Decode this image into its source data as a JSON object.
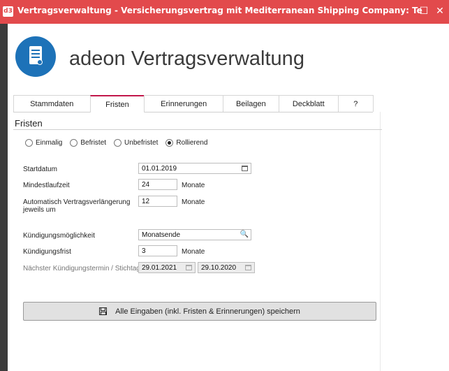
{
  "window": {
    "app_badge": "d3",
    "title": "Vertragsverwaltung - Versicherungsvertrag mit Mediterranean Shipping Company: Test Vertrag (Busines...",
    "maximize_icon": "☐",
    "close_icon": "✕"
  },
  "app": {
    "name": "adeon Vertragsverwaltung"
  },
  "tabs": [
    "Stammdaten",
    "Fristen",
    "Erinnerungen",
    "Beilagen",
    "Deckblatt",
    "?"
  ],
  "active_tab": "Fristen",
  "section": {
    "title": "Fristen"
  },
  "radios": [
    {
      "label": "Einmalig",
      "selected": false
    },
    {
      "label": "Befristet",
      "selected": false
    },
    {
      "label": "Unbefristet",
      "selected": false
    },
    {
      "label": "Rollierend",
      "selected": true
    }
  ],
  "form": {
    "startdatum": {
      "label": "Startdatum",
      "value": "01.01.2019"
    },
    "mindestlaufzeit": {
      "label": "Mindestlaufzeit",
      "value": "24",
      "unit": "Monate"
    },
    "verlaengerung": {
      "label": "Automatisch Vertragsverlängerung jeweils um",
      "value": "12",
      "unit": "Monate"
    },
    "kuendigungsmoeglichkeit": {
      "label": "Kündigungsmöglichkeit",
      "value": "Monatsende"
    },
    "kuendigungsfrist": {
      "label": "Kündigungsfrist",
      "value": "3",
      "unit": "Monate"
    },
    "naechster_termin": {
      "label": "Nächster Kündigungstermin / Stichtag",
      "value1": "29.01.2021",
      "value2": "29.10.2020"
    }
  },
  "save_button": {
    "label": "Alle Eingaben (inkl. Fristen & Erinnerungen) speichern"
  },
  "colors": {
    "titlebar": "#e24a4c",
    "logo": "#1d72b8",
    "active_tab_accent": "#c2174a"
  }
}
